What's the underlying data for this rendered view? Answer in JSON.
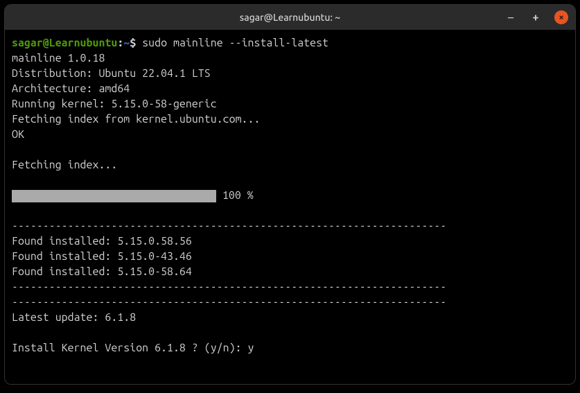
{
  "titlebar": {
    "title": "sagar@Learnubuntu: ~",
    "minimize_icon": "−",
    "maximize_icon": "+",
    "close_icon": "×"
  },
  "prompt": {
    "user_host": "sagar@Learnubuntu",
    "separator": ":",
    "path": "~",
    "symbol": "$"
  },
  "command": "sudo mainline --install-latest",
  "output": {
    "line1": "mainline 1.0.18",
    "line2": "Distribution: Ubuntu 22.04.1 LTS",
    "line3": "Architecture: amd64",
    "line4": "Running kernel: 5.15.0-58-generic",
    "line5": "Fetching index from kernel.ubuntu.com...",
    "line6": "OK",
    "blank1": "",
    "line7": "Fetching index...",
    "blank2": "",
    "progress_pct": " 100 %",
    "blank3": "",
    "sep1": "----------------------------------------------------------------------",
    "line8": "Found installed: 5.15.0.58.56",
    "line9": "Found installed: 5.15.0-43.46",
    "line10": "Found installed: 5.15.0-58.64",
    "sep2": "----------------------------------------------------------------------",
    "sep3": "----------------------------------------------------------------------",
    "line11": "Latest update: 6.1.8",
    "blank4": "",
    "line12": "Install Kernel Version 6.1.8 ? (y/n): y"
  }
}
